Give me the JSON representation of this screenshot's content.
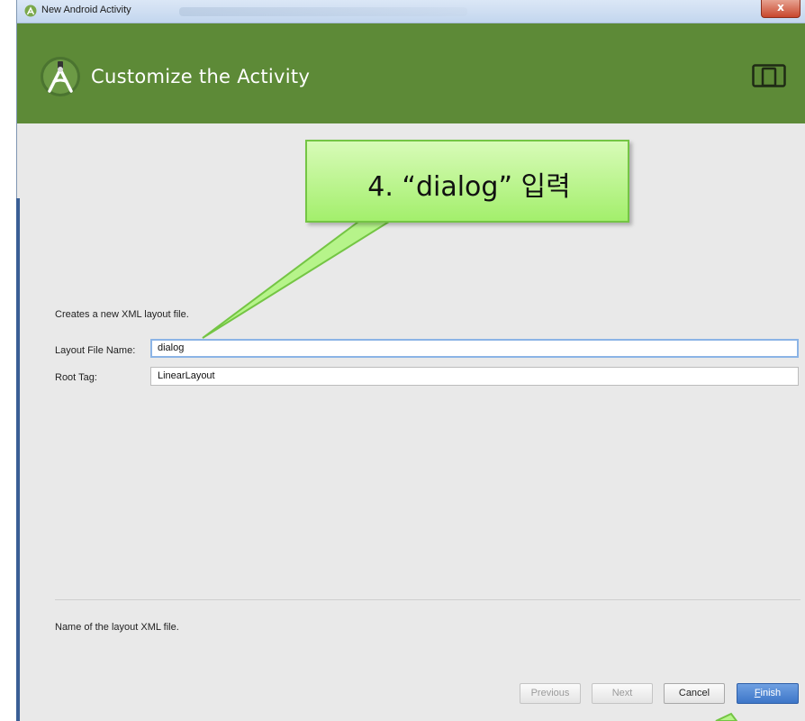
{
  "window": {
    "title": "New Android Activity",
    "close_glyph": "x"
  },
  "header": {
    "heading": "Customize the Activity",
    "logo_icon": "android-studio-icon",
    "device_icon": "phone-tablet-icon",
    "color": "#5d8a37"
  },
  "form": {
    "description": "Creates a new XML layout file.",
    "layout_file_name": {
      "label": "Layout File Name:",
      "value": "dialog"
    },
    "root_tag": {
      "label": "Root Tag:",
      "value": "LinearLayout"
    },
    "hint": "Name of the layout XML file."
  },
  "buttons": {
    "previous": "Previous",
    "next": "Next",
    "cancel": "Cancel",
    "finish_mnemonic": "F",
    "finish_rest": "inish"
  },
  "annotation": {
    "text": "4. “dialog” 입력",
    "color": "#a3ef6c"
  }
}
